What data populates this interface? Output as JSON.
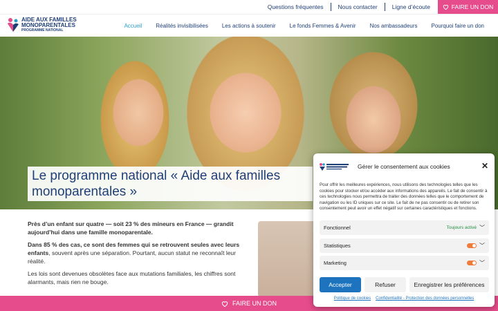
{
  "topbar": {
    "links": [
      "Questions fréquentes",
      "Nous contacter",
      "Ligne d’écoute"
    ],
    "donate": "FAIRE UN DON"
  },
  "logo": {
    "line1": "AIDE AUX FAMILLES",
    "line2": "MONOPARENTALES",
    "line3": "PROGRAMME NATIONAL"
  },
  "nav": {
    "items": [
      "Accueil",
      "Réalités invisibilisées",
      "Les actions à soutenir",
      "Le fonds Femmes & Avenir",
      "Nos ambassadeurs",
      "Pourquoi faire un don"
    ],
    "active_index": 0
  },
  "hero": {
    "title": "Le programme national « Aide aux familles monoparentales »"
  },
  "content": {
    "p1": "Près d’un enfant sur quatre — soit 23 % des mineurs en France — grandit aujourd’hui dans une famille monoparentale.",
    "p2_bold": "Dans 85 % des cas, ce sont des femmes qui se retrouvent seules avec leurs enfants",
    "p2_rest": ", souvent après une séparation. Pourtant, aucun statut ne reconnaît leur réalité.",
    "p3": "Les lois sont devenues obsolètes face aux mutations familiales, les chiffres sont alarmants, mais rien ne bouge."
  },
  "bottombar": {
    "donate": "FAIRE UN DON"
  },
  "cookie": {
    "title": "Gérer le consentement aux cookies",
    "text": "Pour offrir les meilleures expériences, nous utilisons des technologies telles que les cookies pour stocker et/ou accéder aux informations des appareils. Le fait de consentir à ces technologies nous permettra de traiter des données telles que le comportement de navigation ou les ID uniques sur ce site. Le fait de ne pas consentir ou de retirer son consentement peut avoir un effet négatif sur certaines caractéristiques et fonctions.",
    "rows": [
      {
        "label": "Fonctionnel",
        "status": "Toujours activé"
      },
      {
        "label": "Statistiques"
      },
      {
        "label": "Marketing"
      }
    ],
    "accept": "Accepter",
    "refuse": "Refuser",
    "prefs": "Enregistrer les préférences",
    "link1": "Politique de cookies",
    "link2": "Confidentialité - Protection des données personnelles"
  },
  "colors": {
    "brand_blue": "#1f3f77",
    "pink": "#e64c8b",
    "accept_blue": "#1e73be",
    "toggle_orange": "#ef7a3a"
  }
}
